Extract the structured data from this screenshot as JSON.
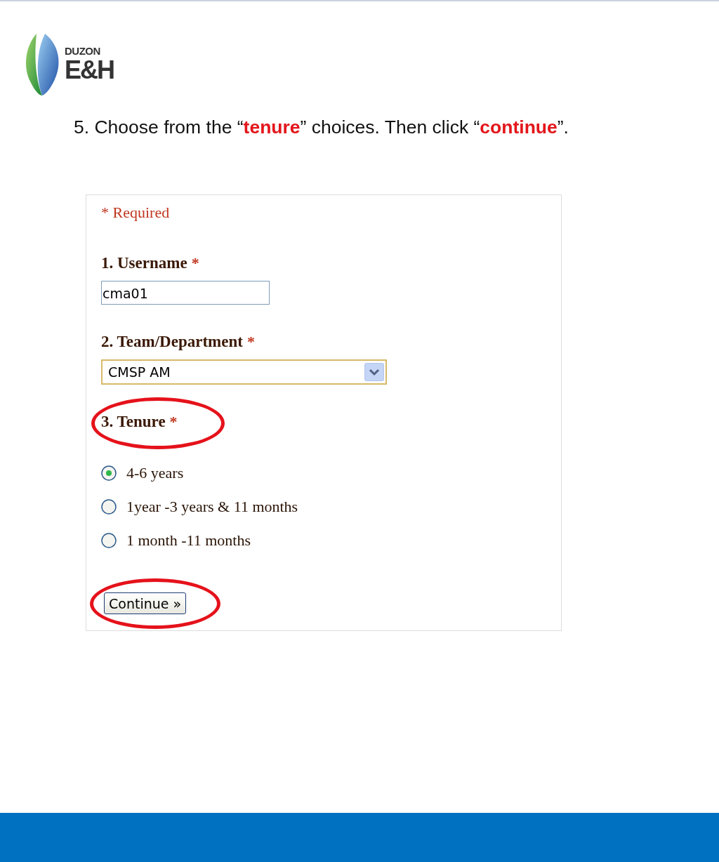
{
  "logo": {
    "line1": "DUZON",
    "line2": "E&H"
  },
  "instruction": "5. Choose from the “**tenure**” choices. Then click “**continue**”.",
  "form": {
    "required_note": "* Required",
    "questions": [
      {
        "kind": "text",
        "label": "1. Username",
        "required_mark": "*",
        "highlighted": false,
        "value": "cma01"
      },
      {
        "kind": "select",
        "label": "2. Team/Department",
        "required_mark": "*",
        "highlighted": false,
        "value": "CMSP AM"
      },
      {
        "kind": "radio",
        "label": "3. Tenure",
        "required_mark": "*",
        "highlighted": true,
        "options": [
          {
            "label": "4-6 years",
            "selected": true
          },
          {
            "label": "1year -3 years & 11 months",
            "selected": false
          },
          {
            "label": "1 month -11 months",
            "selected": false
          }
        ]
      }
    ],
    "submit": {
      "label": "Continue »",
      "highlighted": true
    }
  }
}
